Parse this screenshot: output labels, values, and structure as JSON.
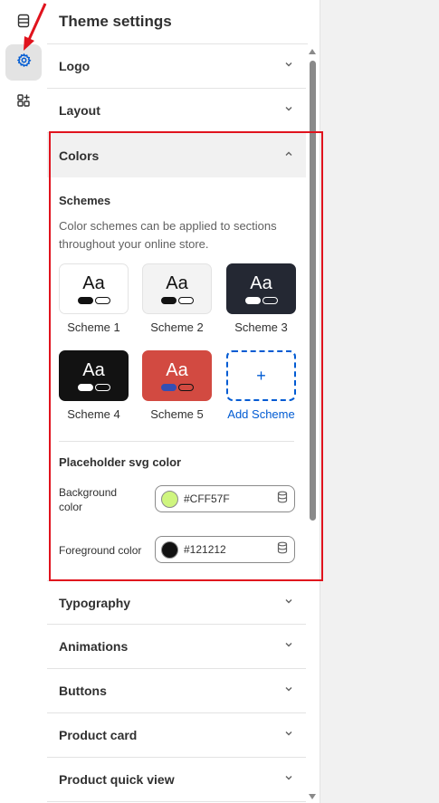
{
  "panel": {
    "title": "Theme settings"
  },
  "sections_top": [
    {
      "label": "Logo"
    },
    {
      "label": "Layout"
    }
  ],
  "colors": {
    "label": "Colors",
    "schemes_heading": "Schemes",
    "schemes_description": "Color schemes can be applied to sections throughout your online store.",
    "schemes": [
      {
        "name": "Scheme 1",
        "sample": "Aa",
        "bg": "#ffffff",
        "text": "#121212",
        "pill1": "#121212",
        "pill2": "#ffffff"
      },
      {
        "name": "Scheme 2",
        "sample": "Aa",
        "bg": "#f3f3f3",
        "text": "#121212",
        "pill1": "#121212",
        "pill2": "#ffffff"
      },
      {
        "name": "Scheme 3",
        "sample": "Aa",
        "bg": "#242833",
        "text": "#ffffff",
        "pill1": "#ffffff",
        "pill2": "#242833"
      },
      {
        "name": "Scheme 4",
        "sample": "Aa",
        "bg": "#121212",
        "text": "#ffffff",
        "pill1": "#ffffff",
        "pill2": "#121212"
      },
      {
        "name": "Scheme 5",
        "sample": "Aa",
        "bg": "#d24a41",
        "text": "#ffffff",
        "pill1": "#334fb4",
        "pill2": "#d24a41"
      }
    ],
    "add_scheme_label": "Add Scheme",
    "add_scheme_symbol": "+",
    "placeholder_heading": "Placeholder svg color",
    "background": {
      "label": "Background color",
      "value": "#CFF57F",
      "swatch": "#cff57f"
    },
    "foreground": {
      "label": "Foreground color",
      "value": "#121212",
      "swatch": "#121212"
    }
  },
  "sections_bottom": [
    {
      "label": "Typography"
    },
    {
      "label": "Animations"
    },
    {
      "label": "Buttons"
    },
    {
      "label": "Product card"
    },
    {
      "label": "Product quick view"
    }
  ],
  "accent": "#005bd3",
  "highlight_color": "#e0131d"
}
